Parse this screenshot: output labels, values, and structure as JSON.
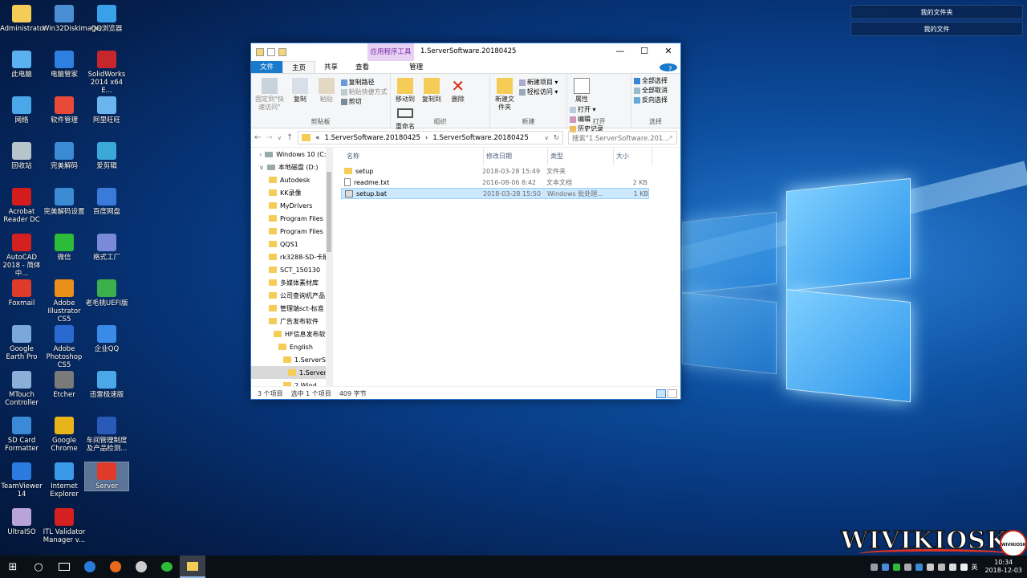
{
  "desktop": {
    "icons": [
      {
        "label": "Administrator",
        "col": 0,
        "row": 0,
        "color": "#f5cd56"
      },
      {
        "label": "Win32DiskImager",
        "col": 1,
        "row": 0,
        "color": "#4a8fd4"
      },
      {
        "label": "QQ浏览器",
        "col": 2,
        "row": 0,
        "color": "#3aa0e8"
      },
      {
        "label": "此电脑",
        "col": 0,
        "row": 1,
        "color": "#5ab0f0"
      },
      {
        "label": "电脑管家",
        "col": 1,
        "row": 1,
        "color": "#2d7fe0"
      },
      {
        "label": "SolidWorks 2014 x64 E...",
        "col": 2,
        "row": 1,
        "color": "#c8262d"
      },
      {
        "label": "网络",
        "col": 0,
        "row": 2,
        "color": "#4aa8e8"
      },
      {
        "label": "软件管理",
        "col": 1,
        "row": 2,
        "color": "#e84a3a"
      },
      {
        "label": "阿里旺旺",
        "col": 2,
        "row": 2,
        "color": "#6ab4f0"
      },
      {
        "label": "回收站",
        "col": 0,
        "row": 3,
        "color": "#b8c4cc"
      },
      {
        "label": "完美解码",
        "col": 1,
        "row": 3,
        "color": "#3a8ad4"
      },
      {
        "label": "爱剪辑",
        "col": 2,
        "row": 3,
        "color": "#3aa8d8"
      },
      {
        "label": "Acrobat Reader DC",
        "col": 0,
        "row": 4,
        "color": "#d41c1c"
      },
      {
        "label": "完美解码设置",
        "col": 1,
        "row": 4,
        "color": "#3a8ad4"
      },
      {
        "label": "百度网盘",
        "col": 2,
        "row": 4,
        "color": "#3a7ad8"
      },
      {
        "label": "AutoCAD 2018 - 简体中...",
        "col": 0,
        "row": 5,
        "color": "#d42020"
      },
      {
        "label": "微信",
        "col": 1,
        "row": 5,
        "color": "#2dbb3a"
      },
      {
        "label": "格式工厂",
        "col": 2,
        "row": 5,
        "color": "#7a8ad8"
      },
      {
        "label": "Foxmail",
        "col": 0,
        "row": 6,
        "color": "#e03a2a"
      },
      {
        "label": "Adobe Illustrator CS5",
        "col": 1,
        "row": 6,
        "color": "#e8901a"
      },
      {
        "label": "老毛桃UEFI版",
        "col": 2,
        "row": 6,
        "color": "#3ab04a"
      },
      {
        "label": "Google Earth Pro",
        "col": 0,
        "row": 7,
        "color": "#7aa8d8"
      },
      {
        "label": "Adobe Photoshop CS5",
        "col": 1,
        "row": 7,
        "color": "#2a6ad0"
      },
      {
        "label": "企业QQ",
        "col": 2,
        "row": 7,
        "color": "#3a8ae8"
      },
      {
        "label": "MTouch Controller",
        "col": 0,
        "row": 8,
        "color": "#8ab0d8"
      },
      {
        "label": "Etcher",
        "col": 1,
        "row": 8,
        "color": "#7a7a7a"
      },
      {
        "label": "迅雷极速版",
        "col": 2,
        "row": 8,
        "color": "#4aa8e8"
      },
      {
        "label": "SD Card Formatter",
        "col": 0,
        "row": 9,
        "color": "#3a8ad8"
      },
      {
        "label": "Google Chrome",
        "col": 1,
        "row": 9,
        "color": "#e8b41a"
      },
      {
        "label": "车间管理制度及产品检测...",
        "col": 2,
        "row": 9,
        "color": "#2a5ab8"
      },
      {
        "label": "TeamViewer 14",
        "col": 0,
        "row": 10,
        "color": "#2a7ae0"
      },
      {
        "label": "Internet Explorer",
        "col": 1,
        "row": 10,
        "color": "#3a9ae8"
      },
      {
        "label": "Server",
        "col": 2,
        "row": 10,
        "color": "#e03a2a",
        "selected": true
      },
      {
        "label": "UltraISO",
        "col": 0,
        "row": 11,
        "color": "#b8a4d8"
      },
      {
        "label": "ITL Validator Manager v...",
        "col": 1,
        "row": 11,
        "color": "#d42020"
      }
    ]
  },
  "explorer": {
    "context_tab": "应用程序工具",
    "title": "1.ServerSoftware.20180425",
    "controls": {
      "minimize": "—",
      "maximize": "☐",
      "close": "✕"
    },
    "tabs": [
      "文件",
      "主页",
      "共享",
      "查看",
      "管理"
    ],
    "help": "?",
    "ribbon": {
      "clipboard": {
        "pin": "固定到\"快速访问\"",
        "copy": "复制",
        "paste": "粘贴",
        "copy_path": "复制路径",
        "paste_shortcut": "粘贴快捷方式",
        "cut": "剪切",
        "label": "剪贴板"
      },
      "organize": {
        "move_to": "移动到",
        "copy_to": "复制到",
        "delete": "删除",
        "rename": "重命名",
        "label": "组织"
      },
      "new": {
        "new_folder": "新建文件夹",
        "new_item": "新建项目 ▾",
        "easy_access": "轻松访问 ▾",
        "label": "新建"
      },
      "open": {
        "properties": "属性",
        "open": "打开 ▾",
        "edit": "编辑",
        "history": "历史记录",
        "label": "打开"
      },
      "select": {
        "select_all": "全部选择",
        "select_none": "全部取消",
        "invert": "反向选择",
        "label": "选择"
      }
    },
    "address": {
      "prefix": "«",
      "crumbs": [
        "1.ServerSoftware.20180425",
        "1.ServerSoftware.20180425"
      ],
      "sep": "›",
      "search_placeholder": "搜索\"1.ServerSoftware.201...",
      "nav_back": "←",
      "nav_forward": "→",
      "nav_history": "∨",
      "nav_up": "↑",
      "dropdown": "∨",
      "refresh": "↻"
    },
    "tree": [
      {
        "label": "Windows 10 (C:)",
        "indent": 0,
        "type": "drive",
        "arrow": "›"
      },
      {
        "label": "本地磁盘 (D:)",
        "indent": 0,
        "type": "drive",
        "arrow": "∨"
      },
      {
        "label": "Autodesk",
        "indent": 1,
        "type": "folder"
      },
      {
        "label": "KK录像",
        "indent": 1,
        "type": "folder"
      },
      {
        "label": "MyDrivers",
        "indent": 1,
        "type": "folder"
      },
      {
        "label": "Program Files",
        "indent": 1,
        "type": "folder"
      },
      {
        "label": "Program Files",
        "indent": 1,
        "type": "folder"
      },
      {
        "label": "QQS1",
        "indent": 1,
        "type": "folder"
      },
      {
        "label": "rk3288-SD-卡刷",
        "indent": 1,
        "type": "folder"
      },
      {
        "label": "SCT_150130",
        "indent": 1,
        "type": "folder"
      },
      {
        "label": "多媒体素材库",
        "indent": 1,
        "type": "folder"
      },
      {
        "label": "公司查询机产品",
        "indent": 1,
        "type": "folder"
      },
      {
        "label": "管理端sct-标准",
        "indent": 1,
        "type": "folder"
      },
      {
        "label": "广告发布软件",
        "indent": 1,
        "type": "folder"
      },
      {
        "label": "HF信息发布软",
        "indent": 2,
        "type": "folder"
      },
      {
        "label": "English",
        "indent": 3,
        "type": "folder"
      },
      {
        "label": "1.ServerS",
        "indent": 4,
        "type": "folder"
      },
      {
        "label": "1.Server",
        "indent": 5,
        "type": "folder",
        "selected": true
      },
      {
        "label": "2.Wind",
        "indent": 4,
        "type": "folder"
      }
    ],
    "columns": [
      "名称",
      "修改日期",
      "类型",
      "大小"
    ],
    "files": [
      {
        "name": "setup",
        "date": "2018-03-28 15:49",
        "type": "文件夹",
        "size": "",
        "kind": "folder"
      },
      {
        "name": "readme.txt",
        "date": "2016-08-06 8:42",
        "type": "文本文档",
        "size": "2 KB",
        "kind": "txt"
      },
      {
        "name": "setup.bat",
        "date": "2018-03-28 15:50",
        "type": "Windows 批处理...",
        "size": "1 KB",
        "kind": "bat",
        "selected": true
      }
    ],
    "status": {
      "count": "3 个项目",
      "selected": "选中 1 个项目",
      "size": "409 字节"
    }
  },
  "favorites": [
    "我的文件夹",
    "我的文件"
  ],
  "taskbar": {
    "start": "⊞",
    "search": "○",
    "tray_time": "10:34",
    "tray_date": "2018-12-03",
    "tray_input": "英"
  },
  "watermark": {
    "brand": "WIVIKIOSK",
    "seal": "WIVIKIOSK"
  }
}
